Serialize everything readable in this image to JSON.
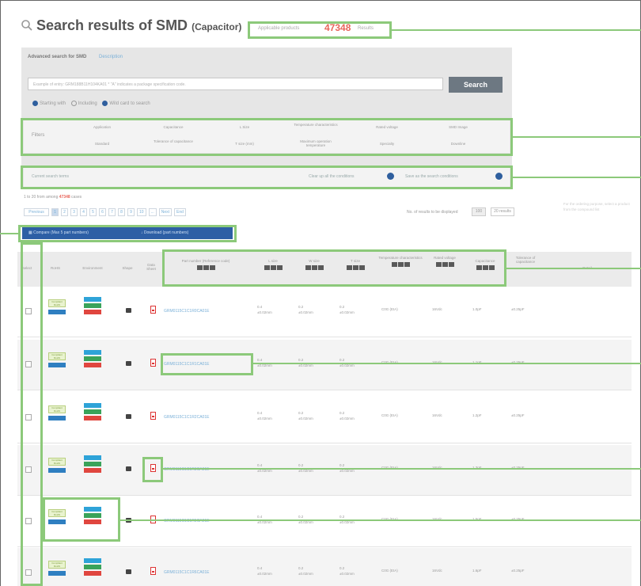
{
  "header": {
    "title": "Search results of SMD",
    "title_sub": "(Capacitor)",
    "count_label": "Applicable products",
    "count": "47348",
    "count_unit": "Results"
  },
  "advanced": {
    "title": "Advanced search for SMD",
    "link": "Description",
    "keyword_placeholder": "Example of entry: GRM188B11H104KA01 * \"A\" indicates a package specification code.",
    "search_button": "Search",
    "option_starting": "Starting with",
    "option_including": "Including",
    "option_wildcard": "Wild card to search",
    "filters_label": "Filters",
    "filters_row1": [
      "Application",
      "Capacitance",
      "L Size",
      "Temperature characteristics",
      "Rated voltage",
      "SMD Image"
    ],
    "filters_row2": [
      "Standard",
      "Tolerance of capacitance",
      "T size (mm)",
      "Maximum operation temperature",
      "Specialty",
      "Downline"
    ],
    "clear_link": "Current search terms",
    "clear_all": "Clear up all the conditions",
    "save_cond": "Save as the search conditions"
  },
  "paging": {
    "info_prefix": "1 to 20 from among",
    "info_count": "47348",
    "info_suffix": "cases",
    "pages": [
      "Previous",
      "1",
      "2",
      "3",
      "4",
      "5",
      "6",
      "7",
      "8",
      "9",
      "10",
      "...",
      "Next",
      "End"
    ],
    "display_label": "No. of results to be displayed",
    "display_100": "100",
    "display_20": "20 results",
    "note": "For the ordering purpose, select a product from the compound list"
  },
  "actions": {
    "compare": "Compare (Max 5 part numbers)",
    "download": "Download (part numbers)"
  },
  "columns": [
    "Select",
    "RoHS",
    "Environment",
    "Shape",
    "Data Sheet",
    "Part number (Reference code)",
    "L size",
    "W size",
    "T size",
    "Temperature characteristics",
    "Rated voltage",
    "Capacitance",
    "Tolerance of capacitance",
    "Detail"
  ],
  "rows": [
    {
      "part": "GRM0115C1C1R0CA01E",
      "l": [
        "0.4",
        "±0.02mm"
      ],
      "w": [
        "0.2",
        "±0.02mm"
      ],
      "t": [
        "0.2",
        "±0.02mm"
      ],
      "temp": "C0G (EIA)",
      "volt": "16Vdc",
      "cap": "1.0pF",
      "tol": "±0.25pF"
    },
    {
      "part": "GRM0115C1C1R1CA01E",
      "l": [
        "0.4",
        "±0.02mm"
      ],
      "w": [
        "0.2",
        "±0.02mm"
      ],
      "t": [
        "0.2",
        "±0.02mm"
      ],
      "temp": "C0G (EIA)",
      "volt": "16Vdc",
      "cap": "1.1pF",
      "tol": "±0.25pF"
    },
    {
      "part": "GRM0115C1C1R2CA01E",
      "l": [
        "0.4",
        "±0.02mm"
      ],
      "w": [
        "0.2",
        "±0.02mm"
      ],
      "t": [
        "0.2",
        "±0.02mm"
      ],
      "temp": "C0G (EIA)",
      "volt": "16Vdc",
      "cap": "1.2pF",
      "tol": "±0.25pF"
    },
    {
      "part": "GRM0115C1C1R3CA01E",
      "l": [
        "0.4",
        "±0.02mm"
      ],
      "w": [
        "0.2",
        "±0.02mm"
      ],
      "t": [
        "0.2",
        "±0.02mm"
      ],
      "temp": "C0G (EIA)",
      "volt": "16Vdc",
      "cap": "1.3pF",
      "tol": "±0.25pF"
    },
    {
      "part": "GRM0115C1C1R5CA01E",
      "l": [
        "0.4",
        "±0.02mm"
      ],
      "w": [
        "0.2",
        "±0.02mm"
      ],
      "t": [
        "0.2",
        "±0.02mm"
      ],
      "temp": "C0G (EIA)",
      "volt": "16Vdc",
      "cap": "1.5pF",
      "tol": "±0.25pF"
    },
    {
      "part": "GRM0115C1C1R6CA01E",
      "l": [
        "0.4",
        "±0.02mm"
      ],
      "w": [
        "0.2",
        "±0.02mm"
      ],
      "t": [
        "0.2",
        "±0.02mm"
      ],
      "temp": "C0G (EIA)",
      "volt": "16Vdc",
      "cap": "1.6pF",
      "tol": "±0.25pF"
    }
  ],
  "badges": {
    "rohs": "Compliant RoHS",
    "env_a": "Halogen",
    "env_b": "Pb free",
    "env_c": "REACH"
  },
  "colors": {
    "accent_red": "#e8645a",
    "nav_blue": "#2d5fa5",
    "highlight_green": "#8cc97a"
  }
}
